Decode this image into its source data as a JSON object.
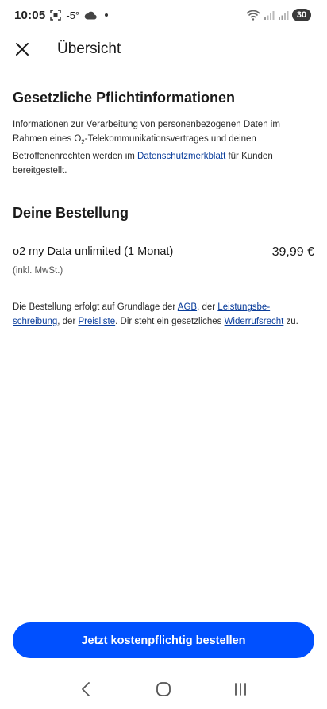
{
  "status_bar": {
    "time": "10:05",
    "temperature": "-5°",
    "battery": "30",
    "icons": [
      "screenshot-icon",
      "cloud-icon",
      "notification-dot-icon",
      "wifi-icon",
      "signal-icon",
      "signal-icon-2",
      "battery-icon"
    ]
  },
  "header": {
    "title": "Übersicht",
    "close_icon": "close-icon"
  },
  "legal": {
    "heading": "Gesetzliche Pflichtinformationen",
    "text_1": "Informationen zur Verarbeitung von personenbezogenen Daten im Rahmen eines O",
    "text_sub": "2",
    "text_2": "-Telekommunikationsvertrages und deinen Betroffenenrechten werden im ",
    "link_privacy": "Datenschutzmerkblatt",
    "text_3": " für Kunden bereitgestellt."
  },
  "order": {
    "heading": "Deine Bestellung",
    "product_name": "o2 my Data unlimited (1 Monat)",
    "price": "39,99 €",
    "vat_note": "(inkl. MwSt.)"
  },
  "terms": {
    "text_1": "Die Bestellung erfolgt auf Grundlage der ",
    "link_agb": "AGB",
    "text_2": ", der ",
    "link_service_desc_1": "Leistungsbe-",
    "link_service_desc_2": "schreibung",
    "text_3": ", der ",
    "link_price_list": "Preisliste",
    "text_4": ". Dir steht ein gesetzliches ",
    "link_withdrawal": "Widerrufsrecht",
    "text_5": " zu."
  },
  "cta": {
    "label": "Jetzt kostenpflichtig bestellen"
  },
  "nav": {
    "icons": [
      "back-icon",
      "home-icon",
      "recents-icon"
    ]
  },
  "colors": {
    "accent": "#0050ff",
    "link": "#0a3d9b",
    "text": "#1a1a1a",
    "background": "#ffffff"
  }
}
